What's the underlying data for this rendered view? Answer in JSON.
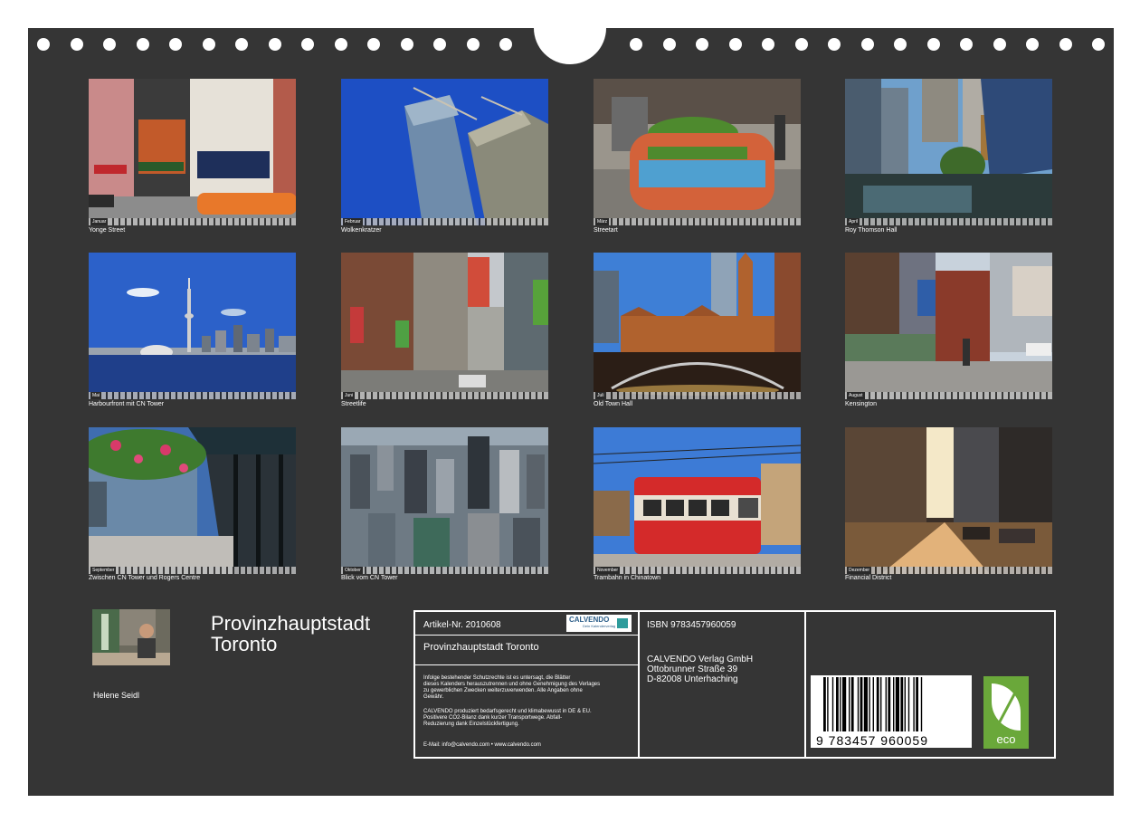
{
  "photos": [
    {
      "caption": "Yonge Street",
      "month": "Januar"
    },
    {
      "caption": "Wolkenkratzer",
      "month": "Februar"
    },
    {
      "caption": "Streetart",
      "month": "März"
    },
    {
      "caption": "Roy Thomson Hall",
      "month": "April"
    },
    {
      "caption": "Harbourfront mit CN Tower",
      "month": "Mai"
    },
    {
      "caption": "Streetlife",
      "month": "Juni"
    },
    {
      "caption": "Old Town Hall",
      "month": "Juli"
    },
    {
      "caption": "Kensington",
      "month": "August"
    },
    {
      "caption": "Zwischen CN Tower und Rogers Centre",
      "month": "September"
    },
    {
      "caption": "Blick vom CN Tower",
      "month": "Oktober"
    },
    {
      "caption": "Trambahn in Chinatown",
      "month": "November"
    },
    {
      "caption": "Financial District",
      "month": "Dezember"
    }
  ],
  "title": {
    "line1": "Provinzhauptstadt",
    "line2": "Toronto"
  },
  "author": "Helene Seidl",
  "info": {
    "article_no": "Artikel-Nr. 2010608",
    "product_title": "Provinzhauptstadt Toronto",
    "rights_1": "Infolge bestehender Schutzrechte ist es untersagt, die Blätter",
    "rights_2": "dieses Kalenders herauszutrennen und ohne Genehmigung des Verlages",
    "rights_3": "zu gewerblichen Zwecken weiterzuverwenden. Alle Angaben ohne",
    "rights_4": "Gewähr.",
    "eco_1": "CALVENDO produziert bedarfsgerecht und klimabewusst in DE & EU.",
    "eco_2": "Positivere CO2-Bilanz dank kurzer Transportwege. Abfall-",
    "eco_3": "Reduzierung dank Einzelstückfertigung.",
    "contact": "E-Mail: info@calvendo.com • www.calvendo.com",
    "isbn": "ISBN 9783457960059",
    "publisher_1": "CALVENDO Verlag GmbH",
    "publisher_2": "Ottobrunner Straße 39",
    "publisher_3": "D-82008 Unterhaching",
    "barcode_number": "9 783457 960059",
    "logo_brand": "CALVENDO",
    "logo_sub": "Dein Kalenderverlag",
    "eco_badge": "eco"
  }
}
